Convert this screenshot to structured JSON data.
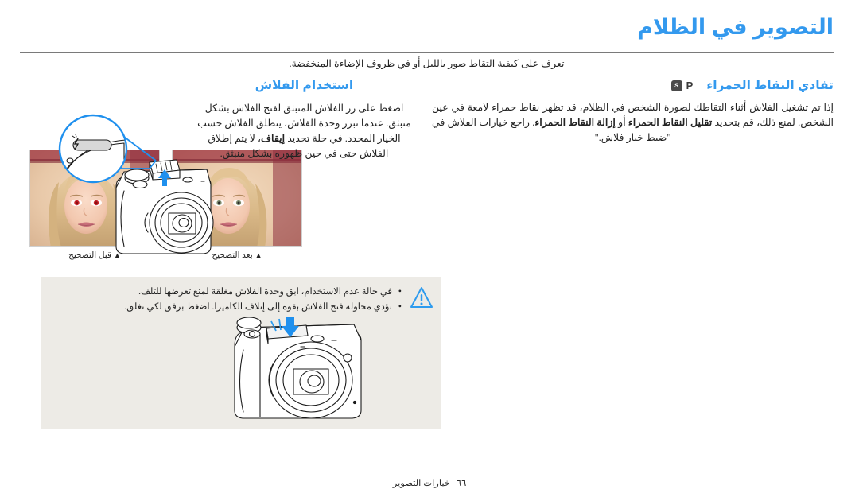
{
  "page": {
    "title": "التصوير في الظلام",
    "subtitle": "تعرف على كيفية التقاط صور بالليل أو في ظروف الإضاءة المنخفضة.",
    "footer_page_number": "٦٦",
    "footer_label": "خيارات التصوير",
    "accent_color": "#3399ee",
    "panel_color": "#edebe6",
    "rule_color": "#7a7a7a"
  },
  "right_column": {
    "heading": "تفادي النقاط الحمراء",
    "mode_badges": [
      {
        "label": "P",
        "style": "plain",
        "name": "mode-badge-p"
      },
      {
        "label": "s",
        "style": "filled",
        "name": "mode-badge-s"
      }
    ],
    "body_part1": "إذا تم تشغيل الفلاش أثناء التقاطك لصورة الشخص في الظلام، قد تظهر نقاط حمراء لامعة في عين الشخص. لمنع ذلك، قم بتحديد ",
    "body_bold1": "تقليل النقاط الحمراء",
    "body_part2": " أو ",
    "body_bold2": "إزالة النقاط الحمراء",
    "body_part3": ". راجع خيارات الفلاش في \"ضبط خيار فلاش.\"",
    "photos": [
      {
        "name": "photo-after-correction",
        "caption": "بعد التصحيح",
        "red_eye": false
      },
      {
        "name": "photo-before-correction",
        "caption": "قبل التصحيح",
        "red_eye": true
      }
    ]
  },
  "left_column": {
    "heading": "استخدام الفلاش",
    "body_part1": "اضغط على زر الفلاش المنبثق لفتح الفلاش بشكل منبثق. عندما تبرز وحدة الفلاش، ينطلق الفلاش حسب الخيار المحدد. في حلة تحديد ",
    "body_bold1": "إيقاف",
    "body_part2": "، لا يتم إطلاق الفلاش حتى في حين ظهوره بشكل منبثق."
  },
  "note_panel": {
    "icon": "warning-triangle-icon",
    "items": [
      "في حالة عدم الاستخدام، ابق وحدة الفلاش مغلقة لمنع تعرضها للتلف.",
      "تؤدي محاولة فتح الفلاش بقوة إلى إتلاف الكاميرا. اضغط برفق لكي تغلق."
    ]
  },
  "illustrations": [
    {
      "name": "camera-flash-button-callout-illustration",
      "description": "رسم توضيحي للكاميرا مع دائرة تكبير تبين زر الفلاش المنبثق"
    },
    {
      "name": "camera-close-flash-illustration",
      "description": "رسم توضيحي للكاميرا يبين الضغط لإغلاق وحدة الفلاش"
    }
  ]
}
